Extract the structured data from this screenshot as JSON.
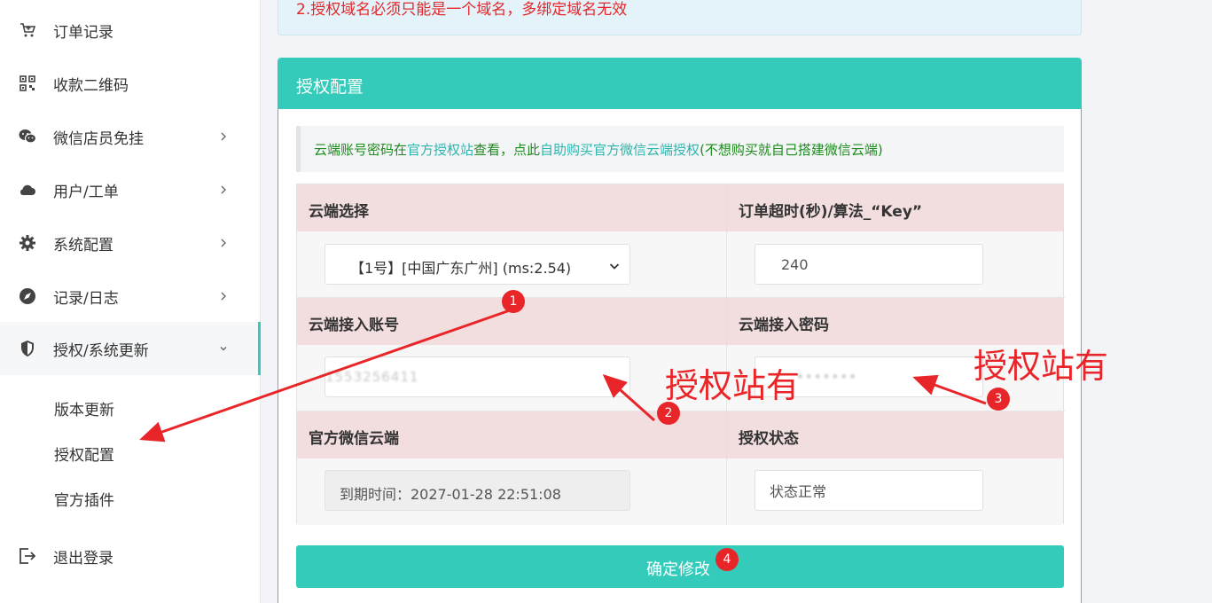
{
  "sidebar": {
    "items": [
      {
        "label": "订单记录",
        "icon": "cart-icon",
        "has_children": false
      },
      {
        "label": "收款二维码",
        "icon": "qrcode-icon",
        "has_children": false
      },
      {
        "label": "微信店员免挂",
        "icon": "wechat-icon",
        "has_children": true
      },
      {
        "label": "用户/工单",
        "icon": "cloud-icon",
        "has_children": true
      },
      {
        "label": "系统配置",
        "icon": "gear-icon",
        "has_children": true
      },
      {
        "label": "记录/日志",
        "icon": "compass-icon",
        "has_children": true
      },
      {
        "label": "授权/系统更新",
        "icon": "shield-icon",
        "has_children": true,
        "expanded": true
      }
    ],
    "subitems": [
      "版本更新",
      "授权配置",
      "官方插件"
    ],
    "logout": {
      "label": "退出登录",
      "icon": "logout-icon"
    }
  },
  "notice": {
    "text": "2.授权域名必须只能是一个域名，多绑定域名无效"
  },
  "panel": {
    "title": "授权配置",
    "hint": {
      "prefix": "云端账号密码在",
      "link1": "官方授权站",
      "middle": "查看，点此",
      "link2": "自助购买官方微信云端授权",
      "suffix": "(不想购买就自己搭建微信云端)"
    },
    "fields": {
      "cloud_select": {
        "label": "云端选择",
        "value": "【1号】[中国广东广州] (ms:2.54)"
      },
      "timeout": {
        "label": "订单超时(秒)/算法_“Key”",
        "value": "240"
      },
      "account": {
        "label": "云端接入账号",
        "value": "1553256411"
      },
      "password": {
        "label": "云端接入密码",
        "value": "•••••••"
      },
      "wechat_cloud": {
        "label": "官方微信云端",
        "value": "到期时间：2027-01-28 22:51:08"
      },
      "auth_status": {
        "label": "授权状态",
        "value": "状态正常"
      }
    },
    "submit_label": "确定修改"
  },
  "annotations": {
    "badges": [
      "1",
      "2",
      "3",
      "4"
    ],
    "callout_left": "授权站有",
    "callout_right": "授权站有",
    "color": "#e8262a"
  },
  "colors": {
    "accent": "#34cbbb",
    "header_cell": "#f3dedf",
    "notice_text": "#e3282b",
    "hint_text": "#1d8b1d"
  }
}
